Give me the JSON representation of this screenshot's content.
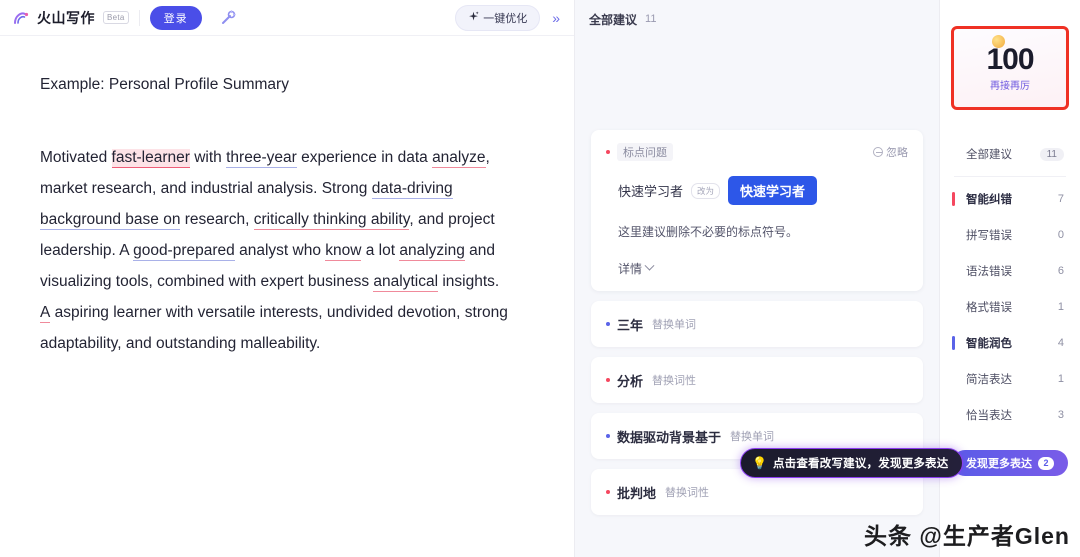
{
  "topbar": {
    "brand_name": "火山写作",
    "beta_label": "Beta",
    "login_label": "登录",
    "magic_icon": "magic-wand-icon",
    "optimize_label": "一键优化",
    "optimize_icon": "sparkle-icon",
    "expand_icon": "»"
  },
  "document": {
    "title": "Example: Personal Profile Summary",
    "paragraph": {
      "s1": "Motivated ",
      "m1": "fast-learner",
      "s2": " with ",
      "m2": "three-year",
      "s3": " experience in data ",
      "m3": "analyze",
      "s4": ", market research, and industrial analysis. Strong ",
      "m4": "data-driving background base on",
      "s5": " research, ",
      "m5": "critically thinking ability",
      "s6": ", and project leadership. A ",
      "m6": "good-prepared",
      "s7": " analyst who ",
      "m7": "know",
      "s8": " a lot ",
      "m8": "analyzing",
      "s9": " and visualizing tools, combined with expert business ",
      "m9": "analytical",
      "s10": " insights. ",
      "m10": "A",
      "s11": " aspiring learner with versatile interests, undivided devotion, strong adaptability, and outstanding malleability."
    }
  },
  "suggestions": {
    "header_title": "全部建议",
    "header_count": "11",
    "card": {
      "tag": "标点问题",
      "ignore_label": "忽略",
      "ignore_icon": "minus-circle-icon",
      "old_word": "快速学习者",
      "arrow_label": "改为",
      "new_word": "快速学习者",
      "description": "这里建议删除不必要的标点符号。",
      "detail_label": "详情",
      "detail_icon": "chevron-down-icon"
    },
    "rows": [
      {
        "word": "三年",
        "tag": "替换单词",
        "dot": "blue"
      },
      {
        "word": "分析",
        "tag": "替换词性",
        "dot": "red"
      },
      {
        "word": "数据驱动背景基于",
        "tag": "替换单词",
        "dot": "blue"
      },
      {
        "word": "批判地",
        "tag": "替换词性",
        "dot": "red"
      }
    ],
    "tooltip": {
      "icon": "lightbulb-icon",
      "text": "点击查看改写建议，发现更多表达"
    }
  },
  "stats": {
    "score": "100",
    "score_caption": "再接再厉",
    "score_emoji": "smiley-icon",
    "items": [
      {
        "label": "全部建议",
        "count": "11",
        "bar": "none",
        "group": false,
        "pill": true
      },
      {
        "label": "智能纠错",
        "count": "7",
        "bar": "red",
        "group": true,
        "pill": false
      },
      {
        "label": "拼写错误",
        "count": "0",
        "bar": "none",
        "group": false,
        "pill": false
      },
      {
        "label": "语法错误",
        "count": "6",
        "bar": "none",
        "group": false,
        "pill": false
      },
      {
        "label": "格式错误",
        "count": "1",
        "bar": "none",
        "group": false,
        "pill": false
      },
      {
        "label": "智能润色",
        "count": "4",
        "bar": "blue",
        "group": true,
        "pill": false
      },
      {
        "label": "简洁表达",
        "count": "1",
        "bar": "none",
        "group": false,
        "pill": false
      },
      {
        "label": "恰当表达",
        "count": "3",
        "bar": "none",
        "group": false,
        "pill": false
      }
    ],
    "more_label": "发现更多表达",
    "more_count": "2"
  },
  "watermark": "头条 @生产者Glen",
  "colors": {
    "accent_blue": "#4a4ee8",
    "error_red": "#f5475f",
    "polish_blue": "#5a63e8",
    "score_border": "#ef3124"
  }
}
